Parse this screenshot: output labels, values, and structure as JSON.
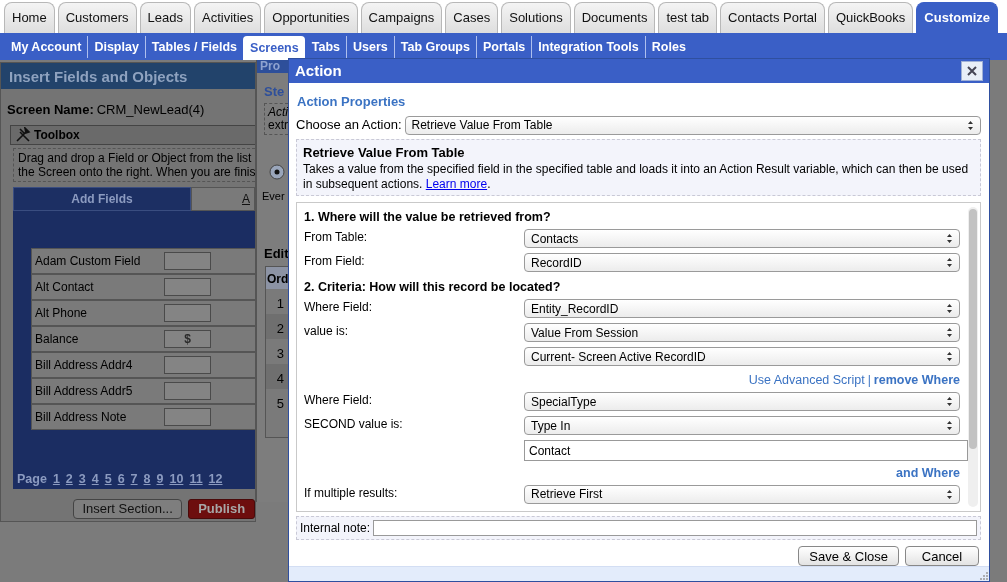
{
  "main_tabs": [
    {
      "label": "Home",
      "selected": false
    },
    {
      "label": "Customers",
      "selected": false
    },
    {
      "label": "Leads",
      "selected": false
    },
    {
      "label": "Activities",
      "selected": false
    },
    {
      "label": "Opportunities",
      "selected": false
    },
    {
      "label": "Campaigns",
      "selected": false
    },
    {
      "label": "Cases",
      "selected": false
    },
    {
      "label": "Solutions",
      "selected": false
    },
    {
      "label": "Documents",
      "selected": false
    },
    {
      "label": "test tab",
      "selected": false
    },
    {
      "label": "Contacts Portal",
      "selected": false
    },
    {
      "label": "QuickBooks",
      "selected": false
    },
    {
      "label": "Customize",
      "selected": true
    }
  ],
  "sub_tabs": [
    {
      "label": "My Account",
      "selected": false
    },
    {
      "label": "Display",
      "selected": false
    },
    {
      "label": "Tables / Fields",
      "selected": false
    },
    {
      "label": "Screens",
      "selected": true
    },
    {
      "label": "Tabs",
      "selected": false
    },
    {
      "label": "Users",
      "selected": false
    },
    {
      "label": "Tab Groups",
      "selected": false
    },
    {
      "label": "Portals",
      "selected": false
    },
    {
      "label": "Integration Tools",
      "selected": false
    },
    {
      "label": "Roles",
      "selected": false
    }
  ],
  "insert_panel": {
    "title": "Insert Fields and Objects",
    "screen_name_label": "Screen Name:",
    "screen_name": "CRM_NewLead(4)",
    "toolbox_title": "Toolbox",
    "instructions": [
      "Drag and drop a Field or Object from the list",
      "the Screen onto the right. When you are finis"
    ],
    "tabs": [
      {
        "label": "Add Fields",
        "selected": true
      },
      {
        "label": "A",
        "selected": false
      }
    ],
    "fields": [
      {
        "label": "Adam Custom Field"
      },
      {
        "label": "Alt Contact"
      },
      {
        "label": "Alt Phone"
      },
      {
        "label": "Balance",
        "value": "$"
      },
      {
        "label": "Bill Address Addr4"
      },
      {
        "label": "Bill Address Addr5"
      },
      {
        "label": "Bill Address Note"
      }
    ],
    "pager": {
      "label": "Page",
      "pages": [
        "1",
        "2",
        "3",
        "4",
        "5",
        "6",
        "7",
        "8",
        "9",
        "10",
        "11",
        "12"
      ]
    },
    "buttons": [
      {
        "label": "Insert Section...",
        "kind": "default"
      },
      {
        "label": "Publish",
        "kind": "danger"
      }
    ]
  },
  "process_panel": {
    "title": "Pro",
    "step": "Ste",
    "lines": [
      "Acti",
      "extr"
    ],
    "radio": {
      "selected": true
    },
    "event_label": "Ever",
    "edit_heading": "Edit",
    "order_header": "Ord",
    "order_rows": [
      "1",
      "2",
      "3",
      "4",
      "5"
    ]
  },
  "dialog": {
    "title": "Action",
    "section_title": "Action Properties",
    "choose_label": "Choose an Action:",
    "choose_value": "Retrieve Value From Table",
    "description": {
      "title": "Retrieve Value From Table",
      "text": "Takes a value from the specified field in the specified table and loads it into an Action Result variable, which can then be used in subsequent actions.",
      "link": "Learn more",
      "after": "."
    },
    "form": [
      {
        "kind": "heading",
        "text": "1. Where will the value be retrieved from?"
      },
      {
        "kind": "select",
        "label": "From Table:",
        "value": "Contacts"
      },
      {
        "kind": "select",
        "label": "From Field:",
        "value": "RecordID"
      },
      {
        "kind": "heading",
        "text": "2. Criteria: How will this record be located?"
      },
      {
        "kind": "select",
        "label": "Where Field:",
        "value": "Entity_RecordID"
      },
      {
        "kind": "select",
        "label": "value is:",
        "value": "Value From Session"
      },
      {
        "kind": "select",
        "value": "Current- Screen Active RecordID"
      },
      {
        "kind": "links",
        "separator": "|",
        "links": [
          {
            "text": "Use Advanced Script",
            "bold": false
          },
          {
            "text": "remove Where",
            "bold": true
          }
        ]
      },
      {
        "kind": "select",
        "label": "Where Field:",
        "value": "SpecialType"
      },
      {
        "kind": "select",
        "label": "SECOND value is:",
        "value": "Type In"
      },
      {
        "kind": "input",
        "value": "Contact"
      },
      {
        "kind": "links",
        "links": [
          {
            "text": "and Where",
            "bold": true
          }
        ]
      },
      {
        "kind": "select",
        "label": "If multiple results:",
        "value": "Retrieve First"
      }
    ],
    "note_label": "Internal note:",
    "buttons": [
      "Save & Close",
      "Cancel"
    ]
  }
}
